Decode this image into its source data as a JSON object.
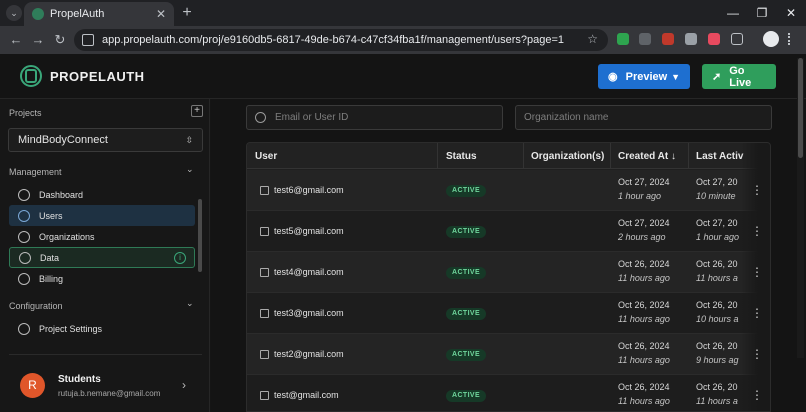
{
  "browser": {
    "tab_title": "PropelAuth",
    "url": "app.propelauth.com/proj/e9160db5-6817-49de-b674-c47cf34fba1f/management/users?page=1"
  },
  "header": {
    "brand": "PROPELAUTH",
    "preview_label": "Preview",
    "golive_label": "Go Live",
    "preview_color": "#1e6fd0",
    "golive_color": "#2f9e5c"
  },
  "sidebar": {
    "projects_heading": "Projects",
    "selected_project": "MindBodyConnect",
    "management_heading": "Management",
    "management_items": [
      {
        "label": "Dashboard",
        "icon": "dashboard-icon"
      },
      {
        "label": "Users",
        "icon": "users-icon",
        "active": true
      },
      {
        "label": "Organizations",
        "icon": "organizations-icon"
      },
      {
        "label": "Data",
        "icon": "data-icon"
      },
      {
        "label": "Billing",
        "icon": "billing-icon"
      }
    ],
    "configuration_heading": "Configuration",
    "configuration_items": [
      {
        "label": "Project Settings",
        "icon": "settings-icon"
      }
    ],
    "account": {
      "initial": "R",
      "name": "Students",
      "email": "rutuja.b.nemane@gmail.com",
      "avatar_color": "#e0562a"
    }
  },
  "filters": {
    "email_placeholder": "Email or User ID",
    "org_placeholder": "Organization name"
  },
  "table": {
    "columns": [
      "User",
      "Status",
      "Organization(s)",
      "Created At",
      "Last Activ"
    ],
    "sort_indicator": "↓",
    "rows": [
      {
        "email": "test6@gmail.com",
        "status": "ACTIVE",
        "created": "Oct 27, 2024",
        "created_ago": "1 hour ago",
        "last": "Oct 27, 20",
        "last_ago": "10 minute"
      },
      {
        "email": "test5@gmail.com",
        "status": "ACTIVE",
        "created": "Oct 27, 2024",
        "created_ago": "2 hours ago",
        "last": "Oct 27, 20",
        "last_ago": "1 hour ago"
      },
      {
        "email": "test4@gmail.com",
        "status": "ACTIVE",
        "created": "Oct 26, 2024",
        "created_ago": "11 hours ago",
        "last": "Oct 26, 20",
        "last_ago": "11 hours a"
      },
      {
        "email": "test3@gmail.com",
        "status": "ACTIVE",
        "created": "Oct 26, 2024",
        "created_ago": "11 hours ago",
        "last": "Oct 26, 20",
        "last_ago": "10 hours a"
      },
      {
        "email": "test2@gmail.com",
        "status": "ACTIVE",
        "created": "Oct 26, 2024",
        "created_ago": "11 hours ago",
        "last": "Oct 26, 20",
        "last_ago": "9 hours ag"
      },
      {
        "email": "test@gmail.com",
        "status": "ACTIVE",
        "created": "Oct 26, 2024",
        "created_ago": "11 hours ago",
        "last": "Oct 26, 20",
        "last_ago": "11 hours a"
      }
    ]
  }
}
